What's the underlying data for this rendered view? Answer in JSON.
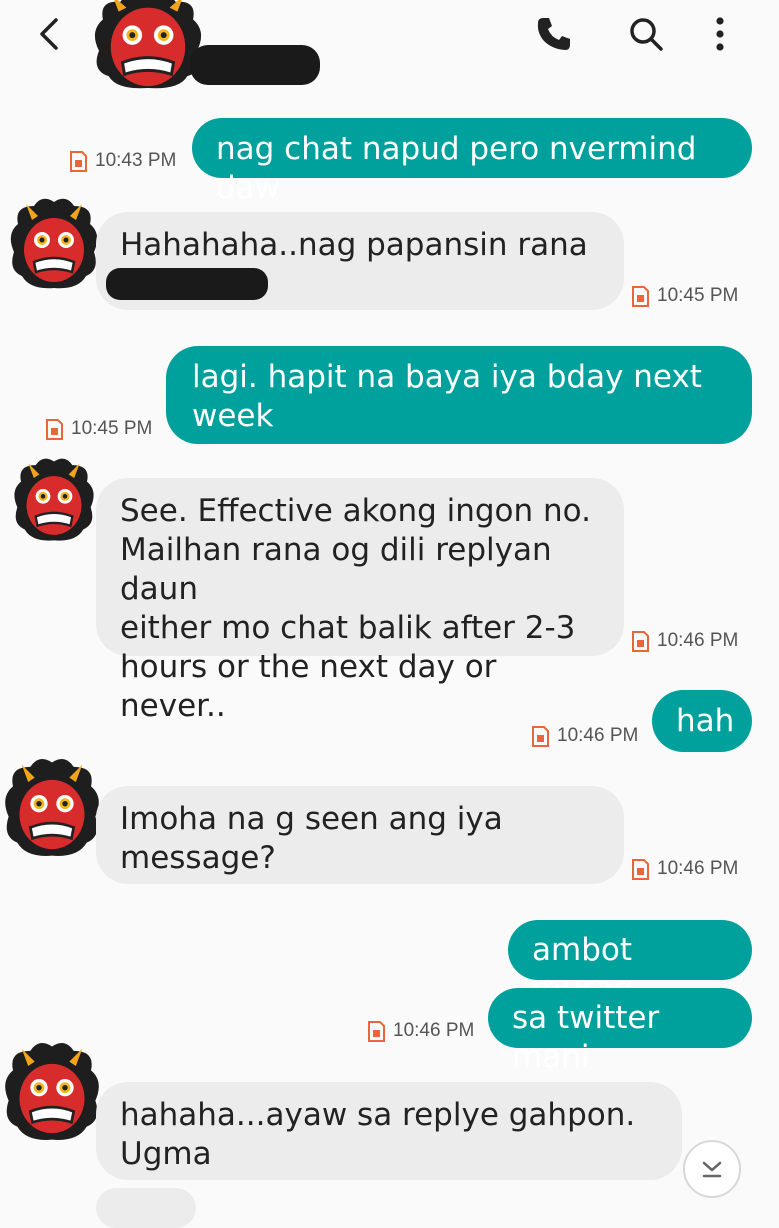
{
  "header": {
    "back_icon": "chevron-left-icon",
    "call_icon": "phone-icon",
    "search_icon": "search-icon",
    "menu_icon": "more-vert-icon"
  },
  "colors": {
    "outgoing": "#00a19c",
    "incoming": "#ececec",
    "sim_badge": "#e8663a"
  },
  "messages": [
    {
      "dir": "out",
      "text": "nag chat napud pero nvermind daw",
      "time": "10:43 PM"
    },
    {
      "dir": "in",
      "text": "Hahahaha..nag papansin rana",
      "time": "10:45 PM"
    },
    {
      "dir": "out",
      "text": "lagi. hapit na baya iya bday next\nweek",
      "time": "10:45 PM"
    },
    {
      "dir": "in",
      "text": "See. Effective akong ingon no.\nMailhan rana og dili replyan daun\neither mo chat balik after 2-3\nhours or the next day or never..",
      "time": "10:46 PM"
    },
    {
      "dir": "out",
      "text": "hah",
      "time": "10:46 PM"
    },
    {
      "dir": "in",
      "text": "Imoha na g seen ang iya\nmessage?",
      "time": "10:46 PM"
    },
    {
      "dir": "out",
      "text": "ambot murag",
      "time": ""
    },
    {
      "dir": "out",
      "text": "sa twitter mani",
      "time": "10:46 PM"
    },
    {
      "dir": "in",
      "text": "hahaha...ayaw sa replye gahpon.\nUgma",
      "time": ""
    }
  ],
  "scroll_down_icon": "chevron-down-icon"
}
